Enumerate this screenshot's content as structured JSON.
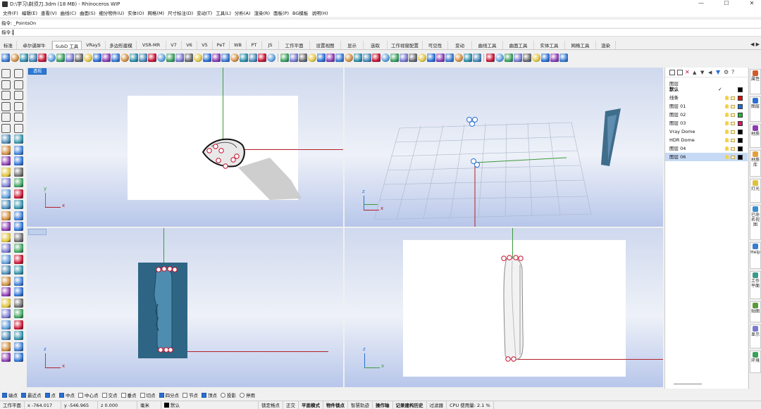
{
  "window": {
    "title": "D:\\学习\\剃须刀.3dm (18 MB) - Rhinoceros WIP",
    "min": "—",
    "max": "☐",
    "close": "✕"
  },
  "menu": [
    "文件(F)",
    "编辑(E)",
    "查看(V)",
    "曲线(C)",
    "曲面(S)",
    "细分物件(U)",
    "实体(O)",
    "网格(M)",
    "尺寸标注(D)",
    "变动(T)",
    "工具(L)",
    "分析(A)",
    "渲染(R)",
    "面板(P)",
    "BG模板",
    "说明(H)"
  ],
  "command": {
    "history": "指令: _PointsOn",
    "prompt": "指令:"
  },
  "tabs": [
    "标准",
    "卓尔谟犀牛",
    "SubD 工具",
    "VRay5",
    "多边形建模",
    "VSR-MR",
    "V7",
    "V6",
    "V5",
    "PeT",
    "WB",
    "PT",
    "JS",
    "工作平面",
    "设置视图",
    "显示",
    "选取",
    "工作视窗配置",
    "可见性",
    "变动",
    "曲线工具",
    "曲面工具",
    "实体工具",
    "网格工具",
    "渲染"
  ],
  "active_tab_index": 2,
  "toolbar_icons": [
    "box-icon",
    "cone-icon",
    "cylinder-icon",
    "sphere-icon",
    "torus-icon",
    "ellipsoid-icon",
    "tube-icon",
    "capsule-icon",
    "pyramid-icon",
    "plane-icon",
    "extrude-icon",
    "revolve-icon",
    "loft-icon",
    "sweep-icon",
    "bridge-icon",
    "crease-icon",
    "subdivide-icon",
    "insert-edge-icon",
    "slide-icon",
    "stitch-icon",
    "merge-icon",
    "fill-icon",
    "offset-icon",
    "mirror-icon",
    "symmetry-icon",
    "append-icon",
    "bevel-icon",
    "weld-icon",
    "flip-icon",
    "patch-icon",
    "grid-icon",
    "render-icon",
    "material-icon",
    "light-icon",
    "sun-icon",
    "camera-icon",
    "layer-icon",
    "properties-icon",
    "select-icon",
    "lasso-icon",
    "gumball-icon",
    "snap-icon",
    "analysis-icon",
    "zebra-icon",
    "curvature-icon",
    "draft-icon",
    "environment-icon",
    "display-icon",
    "wire-icon",
    "shade-icon",
    "ghost-icon",
    "xray-icon",
    "tech-icon",
    "artistic-icon",
    "pen-icon",
    "arctic-icon",
    "rendered-icon",
    "raytrace-icon",
    "record-icon",
    "history-icon",
    "help-icon"
  ],
  "viewports": [
    {
      "label": "透视",
      "axes": [
        "y",
        "x"
      ]
    },
    {
      "label": "",
      "axes": [
        "z",
        "x"
      ]
    },
    {
      "label": "",
      "axes": [
        "z",
        "x"
      ]
    },
    {
      "label": "",
      "axes": [
        "z",
        "x"
      ]
    }
  ],
  "layers": {
    "title": "图层",
    "rows": [
      {
        "name": "默认",
        "check": "✓",
        "bold": true,
        "color": "#000000",
        "bulb": false
      },
      {
        "name": "线条",
        "check": "",
        "bold": false,
        "color": "#e01010",
        "bulb": true
      },
      {
        "name": "图层 01",
        "check": "",
        "bold": false,
        "color": "#1c6fd6",
        "bulb": true
      },
      {
        "name": "图层 02",
        "check": "",
        "bold": false,
        "color": "#22b43c",
        "bulb": true
      },
      {
        "name": "图层 03",
        "check": "",
        "bold": false,
        "color": "#d0186c",
        "bulb": true
      },
      {
        "name": "Vray Dome",
        "check": "",
        "bold": false,
        "color": "#000000",
        "bulb": true
      },
      {
        "name": "HDR Dome",
        "check": "",
        "bold": false,
        "color": "#000000",
        "bulb": true
      },
      {
        "name": "图层 04",
        "check": "",
        "bold": false,
        "color": "#000000",
        "bulb": true
      },
      {
        "name": "图层 06",
        "check": "",
        "bold": false,
        "color": "#000000",
        "bulb": true,
        "selected": true
      }
    ]
  },
  "side_tabs": [
    {
      "label": "属性",
      "color": "#d45a2a"
    },
    {
      "label": "图层",
      "color": "#2a6fd2"
    },
    {
      "label": "材质",
      "color": "#8c3ab0"
    },
    {
      "label": "材质库",
      "color": "#e6a13a"
    },
    {
      "label": "灯光",
      "color": "#e0c23a"
    },
    {
      "label": "已命名视图",
      "color": "#3a8cd0"
    },
    {
      "label": "Help",
      "color": "#3a7ad0"
    },
    {
      "label": "工作平面",
      "color": "#3a9a8c"
    },
    {
      "label": "贴图",
      "color": "#5a9a3a"
    },
    {
      "label": "显示",
      "color": "#7a7ad0"
    },
    {
      "label": "环境",
      "color": "#3aa05a"
    }
  ],
  "osnaps": [
    {
      "label": "端点",
      "on": true
    },
    {
      "label": "最近点",
      "on": true
    },
    {
      "label": "点",
      "on": true
    },
    {
      "label": "中点",
      "on": true
    },
    {
      "label": "中心点",
      "on": false
    },
    {
      "label": "交点",
      "on": false
    },
    {
      "label": "垂点",
      "on": false
    },
    {
      "label": "切点",
      "on": false
    },
    {
      "label": "四分点",
      "on": true
    },
    {
      "label": "节点",
      "on": false
    },
    {
      "label": "顶点",
      "on": true
    },
    {
      "label": "投影",
      "on": false,
      "radio": true
    },
    {
      "label": "停用",
      "on": false,
      "radio": true
    }
  ],
  "status": {
    "cplane": "工作平面",
    "x": "x -764.017",
    "y": "y -546.965",
    "z": "z 0.000",
    "unit": "毫米",
    "layer": "默认",
    "items": [
      "锁定格点",
      "正交",
      "平面模式",
      "物件锁点",
      "智慧轨迹",
      "操作轴",
      "记录建构历史",
      "过滤器",
      "CPU 使用量: 2.1 %"
    ],
    "bold_items": [
      2,
      3,
      5,
      6
    ]
  },
  "colors": {
    "x_axis": "#b4202a",
    "y_axis": "#3c9a3c",
    "control_point": "#c8102e",
    "viewport_active": "#2a78d8"
  }
}
